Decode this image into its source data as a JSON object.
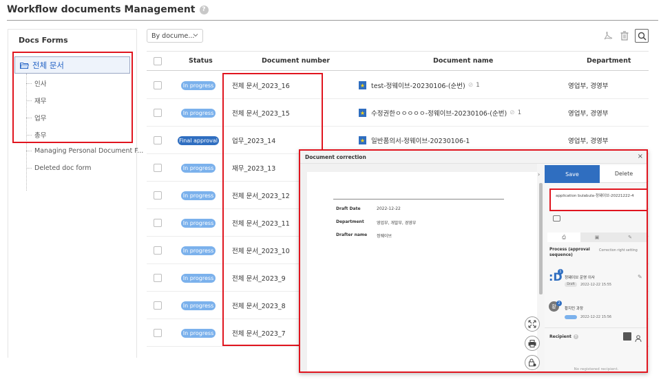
{
  "page": {
    "title": "Workflow documents Management",
    "help": "?"
  },
  "sidebar": {
    "title": "Docs Forms",
    "root": "전체 문서",
    "items": [
      "인사",
      "재무",
      "업무",
      "총무",
      "Managing Personal Document F...",
      "Deleted doc form"
    ]
  },
  "toolbar": {
    "filter_value": "By docume...",
    "icons": [
      "pdf-icon",
      "trash-icon",
      "search-icon"
    ]
  },
  "table": {
    "headers": [
      "Status",
      "Document number",
      "Document name",
      "Department"
    ],
    "rows": [
      {
        "status": "In progress",
        "number": "전체 문서_2023_16",
        "name": "test-정웨이브-20230106-(순번)",
        "attach": "1",
        "dept": "영업부, 경영부"
      },
      {
        "status": "In progress",
        "number": "전체 문서_2023_15",
        "name": "수정권한ㅇㅇㅇㅇㅇ-정웨이브-20230106-(순번)",
        "attach": "1",
        "dept": "영업부, 경영부"
      },
      {
        "status": "Final approval",
        "number": "업무_2023_14",
        "name": "일반품의서-정웨이브-20230106-1",
        "attach": "",
        "dept": "영업부, 경영부"
      },
      {
        "status": "In progress",
        "number": "재무_2023_13",
        "name": "",
        "attach": "",
        "dept": ""
      },
      {
        "status": "In progress",
        "number": "전체 문서_2023_12",
        "name": "",
        "attach": "",
        "dept": ""
      },
      {
        "status": "In progress",
        "number": "전체 문서_2023_11",
        "name": "",
        "attach": "",
        "dept": ""
      },
      {
        "status": "In progress",
        "number": "전체 문서_2023_10",
        "name": "",
        "attach": "",
        "dept": ""
      },
      {
        "status": "In progress",
        "number": "전체 문서_2023_9",
        "name": "",
        "attach": "",
        "dept": ""
      },
      {
        "status": "In progress",
        "number": "전체 문서_2023_8",
        "name": "",
        "attach": "",
        "dept": ""
      },
      {
        "status": "In progress",
        "number": "전체 문서_2023_7",
        "name": "",
        "attach": "",
        "dept": ""
      }
    ]
  },
  "popup": {
    "title": "Document correction",
    "close": "×",
    "doc": {
      "draft_date_label": "Draft Date",
      "draft_date": "2022-12-22",
      "department_label": "Department",
      "department": "영업부, 개발부, 경영부",
      "drafter_label": "Drafter name",
      "drafter": "정웨이브"
    },
    "save": "Save",
    "delete": "Delete",
    "field_value": "application bulabula-정웨이브-20221222-4",
    "process_title": "Process (approval sequence)",
    "correction_right": "Correction right setting",
    "approvers": [
      {
        "name": "정웨이브 운영 이사",
        "tag": "Draft",
        "date": "2022-12-22 15:55",
        "order": "1"
      },
      {
        "name": "황지민 과장",
        "tag": "",
        "date": "2022-12-22 15:56",
        "order": "2"
      }
    ],
    "recipient_label": "Recipient",
    "no_recipient": "No registered recipient."
  },
  "colors": {
    "accent": "#2f6ec0",
    "badge": "#7bb1ec",
    "highlight": "#e0141e"
  }
}
